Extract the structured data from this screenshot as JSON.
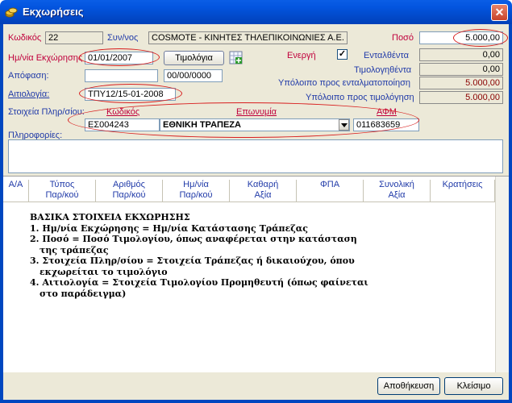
{
  "window": {
    "title": "Εκχωρήσεις",
    "close": "✕"
  },
  "form": {
    "kodikos_label": "Κωδικός",
    "kodikos_value": "22",
    "synvos_label": "Συν/νος",
    "synvos_value": "COSMOTE - ΚΙΝΗΤΕΣ ΤΗΛΕΠΙΚΟΙΝΩΝΙΕΣ Α.Ε.",
    "poso_label": "Ποσό",
    "poso_value": "5.000,00",
    "date_label": "Ημ/νία Εκχώρησης",
    "date_value": "01/01/2007",
    "timologia_button": "Τιμολόγια",
    "energi_label": "Ενεργή",
    "energi_checked": "✓",
    "entalthenta_label": "Ενταλθέντα",
    "entalthenta_value": "0,00",
    "timologithenta_label": "Τιμολογηθέντα",
    "timologithenta_value": "0,00",
    "apofasi_label": "Απόφαση:",
    "apofasi_date": "00/00/0000",
    "ypoloipo_ental_label": "Υπόλοιπο προς ενταλματοποίηση",
    "ypoloipo_ental_value": "5.000,00",
    "aitiologia_label": "Αιτιολογία:",
    "aitiologia_value": "ΤΠΥ12/15-01-2008",
    "ypoloipo_timol_label": "Υπόλοιπο προς τιμολόγηση",
    "ypoloipo_timol_value": "5.000,00",
    "stoixeia_label": "Στοιχεία Πληρ/σίου:",
    "col_kodikos": "Κωδικός",
    "col_eponymia": "Επωνυμία",
    "col_afm": "ΑΦΜ",
    "bank_code": "ΕΣ004243",
    "bank_name": "ΕΘΝΙΚΗ ΤΡΑΠΕΖΑ",
    "afm_value": "011683659",
    "plirofories_label": "Πληροφορίες:"
  },
  "grid": {
    "columns": [
      {
        "l1": "Α/Α",
        "l2": ""
      },
      {
        "l1": "Τύπος",
        "l2": "Παρ/κού"
      },
      {
        "l1": "Αριθμός",
        "l2": "Παρ/κού"
      },
      {
        "l1": "Ημ/νία",
        "l2": "Παρ/κού"
      },
      {
        "l1": "Καθαρή",
        "l2": "Αξία"
      },
      {
        "l1": "ΦΠΑ",
        "l2": ""
      },
      {
        "l1": "Συνολική",
        "l2": "Αξία"
      },
      {
        "l1": "Κρατήσεις",
        "l2": ""
      }
    ]
  },
  "notes": {
    "title": "ΒΑΣΙΚΑ ΣΤΟΙΧΕΙΑ ΕΚΧΩΡΗΣΗΣ",
    "l1": "1. Ημ/νία Εκχώρησης = Ημ/νία Κατάστασης Τράπεζας",
    "l2a": "2. Ποσό = Ποσό Τιμολογίου, όπως αναφέρεται στην κατάσταση",
    "l2b": "της τράπεζας",
    "l3a": "3. Στοιχεία Πληρ/σίου = Στοιχεία Τράπεζας ή δικαιούχου, όπου",
    "l3b": "εκχωρείται το τιμολόγιο",
    "l4a": "4. Αιτιολογία = Στοιχεία Τιμολογίου Προμηθευτή (όπως φαίνεται",
    "l4b": "στο παράδειγμα)"
  },
  "footer": {
    "save_button": "Αποθήκευση",
    "close_button": "Κλείσιμο"
  }
}
